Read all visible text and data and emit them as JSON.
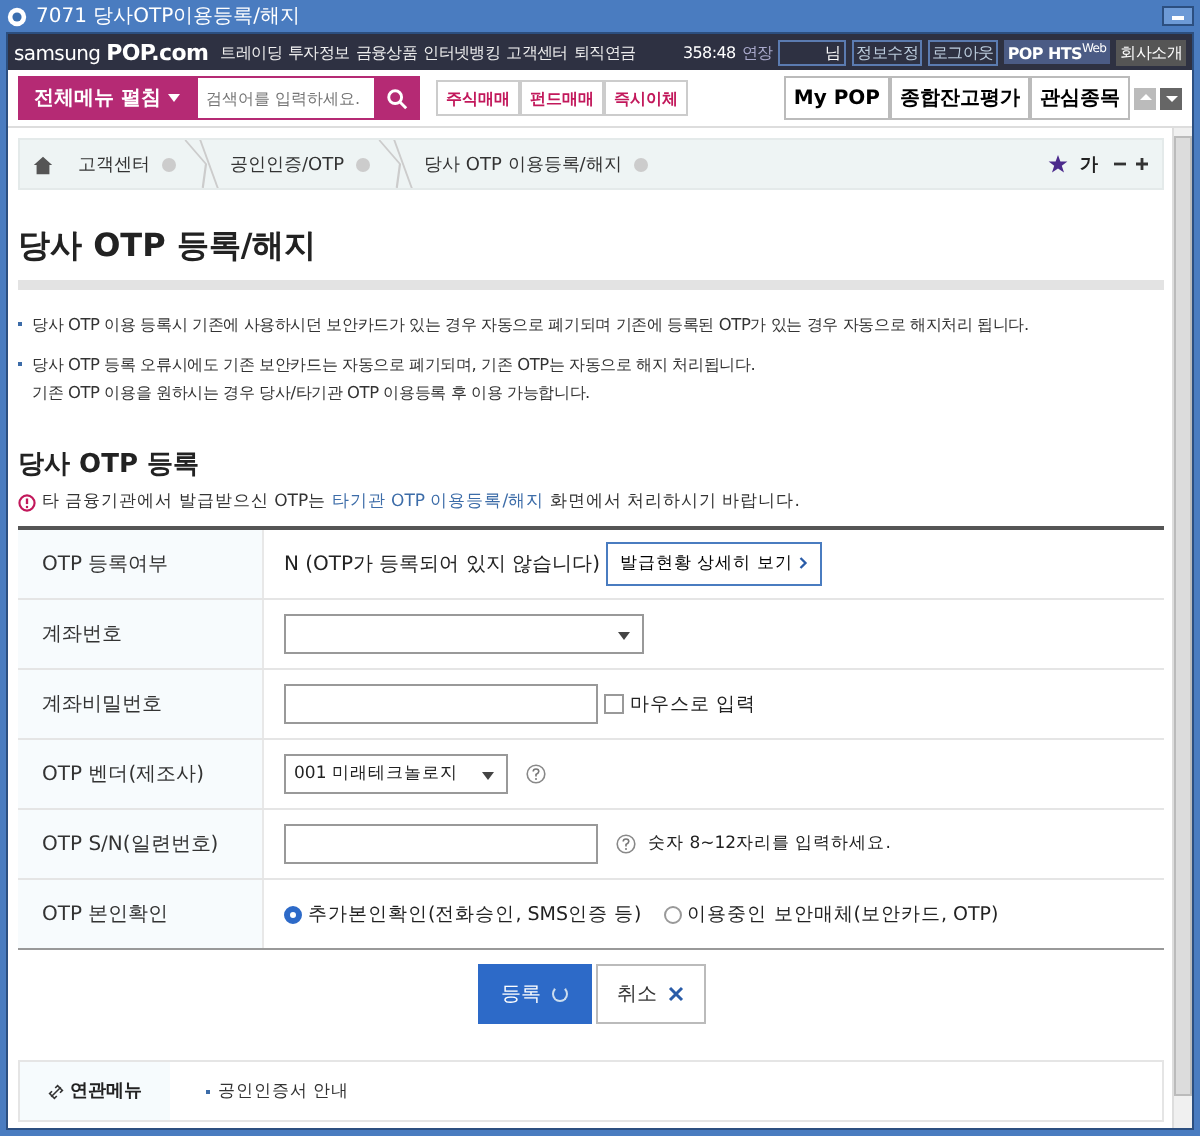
{
  "window": {
    "title": "7071 당사OTP이용등록/해지"
  },
  "nav": {
    "logo_left": "samsung",
    "logo_right": "POP.com",
    "menu": [
      "트레이딩",
      "투자정보",
      "금융상품",
      "인터넷뱅킹",
      "고객센터",
      "퇴직연금"
    ],
    "timer": "358:48",
    "extend": "연장",
    "user": "님",
    "links": [
      "정보수정",
      "로그아웃"
    ],
    "hts": "POP HTS",
    "hts_sup": "Web",
    "company": "회사소개"
  },
  "toolbar": {
    "all_menu": "전체메뉴 펼침",
    "search": {
      "placeholder": "검색어를 입력하세요."
    },
    "quick": [
      "주식매매",
      "펀드매매",
      "즉시이체"
    ],
    "tabs": [
      "My POP",
      "종합잔고평가",
      "관심종목"
    ]
  },
  "breadcrumb": {
    "items": [
      "고객센터",
      "공인인증/OTP",
      "당사 OTP 이용등록/해지"
    ],
    "font": "가"
  },
  "page_title": "당사 OTP 등록/해지",
  "notes": [
    {
      "lines": [
        "당사 OTP 이용 등록시 기존에 사용하시던 보안카드가 있는 경우 자동으로 폐기되며 기존에 등록된 OTP가 있는 경우 자동으로 해지처리 됩니다."
      ]
    },
    {
      "lines": [
        "당사 OTP 등록 오류시에도 기존 보안카드는 자동으로 폐기되며, 기존 OTP는 자동으로 해지 처리됩니다.",
        "기존 OTP 이용을 원하시는 경우 당사/타기관 OTP 이용등록 후 이용 가능합니다."
      ]
    }
  ],
  "section_title": "당사 OTP 등록",
  "notice": {
    "before": "타 금융기관에서 발급받으신 OTP는",
    "link": "타기관 OTP 이용등록/해지",
    "after": "화면에서 처리하시기 바랍니다."
  },
  "form": [
    {
      "kind": "status",
      "label": "OTP 등록여부",
      "value": "N (OTP가 등록되어 있지 않습니다)",
      "button": "발급현황 상세히 보기"
    },
    {
      "kind": "select",
      "label": "계좌번호"
    },
    {
      "kind": "password",
      "label": "계좌비밀번호",
      "checkbox": {
        "label": "마우스로 입력",
        "checked": false
      }
    },
    {
      "kind": "vendor",
      "label": "OTP 벤더(제조사)",
      "value": "001 미래테크놀로지"
    },
    {
      "kind": "serial",
      "label": "OTP S/N(일련번호)",
      "hint": "숫자 8~12자리를 입력하세요."
    },
    {
      "kind": "radio",
      "label": "OTP 본인확인",
      "options": [
        {
          "label": "추가본인확인(전화승인, SMS인증 등)",
          "selected": true
        },
        {
          "label": "이용중인 보안매체(보안카드, OTP)",
          "selected": false
        }
      ]
    }
  ],
  "buttons": [
    {
      "kind": "primary",
      "label": "등록"
    },
    {
      "kind": "cancel",
      "label": "취소"
    }
  ],
  "related": {
    "title": "연관메뉴",
    "items": [
      "공인인증서 안내"
    ]
  }
}
